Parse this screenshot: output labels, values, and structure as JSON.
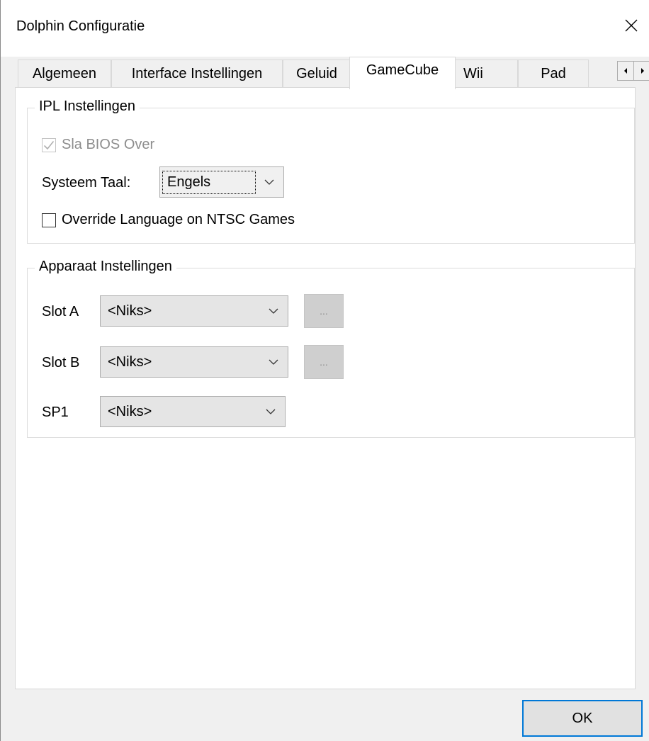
{
  "window": {
    "title": "Dolphin Configuratie"
  },
  "tabs": [
    {
      "label": "Algemeen"
    },
    {
      "label": "Interface Instellingen"
    },
    {
      "label": "Geluid"
    },
    {
      "label": "GameCube",
      "active": true
    },
    {
      "label": "Wii"
    },
    {
      "label": "Pad"
    }
  ],
  "ipl": {
    "title": "IPL Instellingen",
    "skip_bios_label": "Sla BIOS Over",
    "skip_bios_checked": true,
    "skip_bios_disabled": true,
    "language_label": "Systeem Taal:",
    "language_value": "Engels",
    "override_label": "Override Language on NTSC Games",
    "override_checked": false
  },
  "devices": {
    "title": "Apparaat Instellingen",
    "slot_a_label": "Slot A",
    "slot_a_value": "<Niks>",
    "slot_b_label": "Slot B",
    "slot_b_value": "<Niks>",
    "sp1_label": "SP1",
    "sp1_value": "<Niks>",
    "browse_label": "..."
  },
  "buttons": {
    "ok": "OK"
  },
  "icons": {
    "close": "close-icon",
    "chevron": "chevron-down-icon",
    "scroll_left": "arrow-left-icon",
    "scroll_right": "arrow-right-icon",
    "check": "checkmark-icon"
  }
}
